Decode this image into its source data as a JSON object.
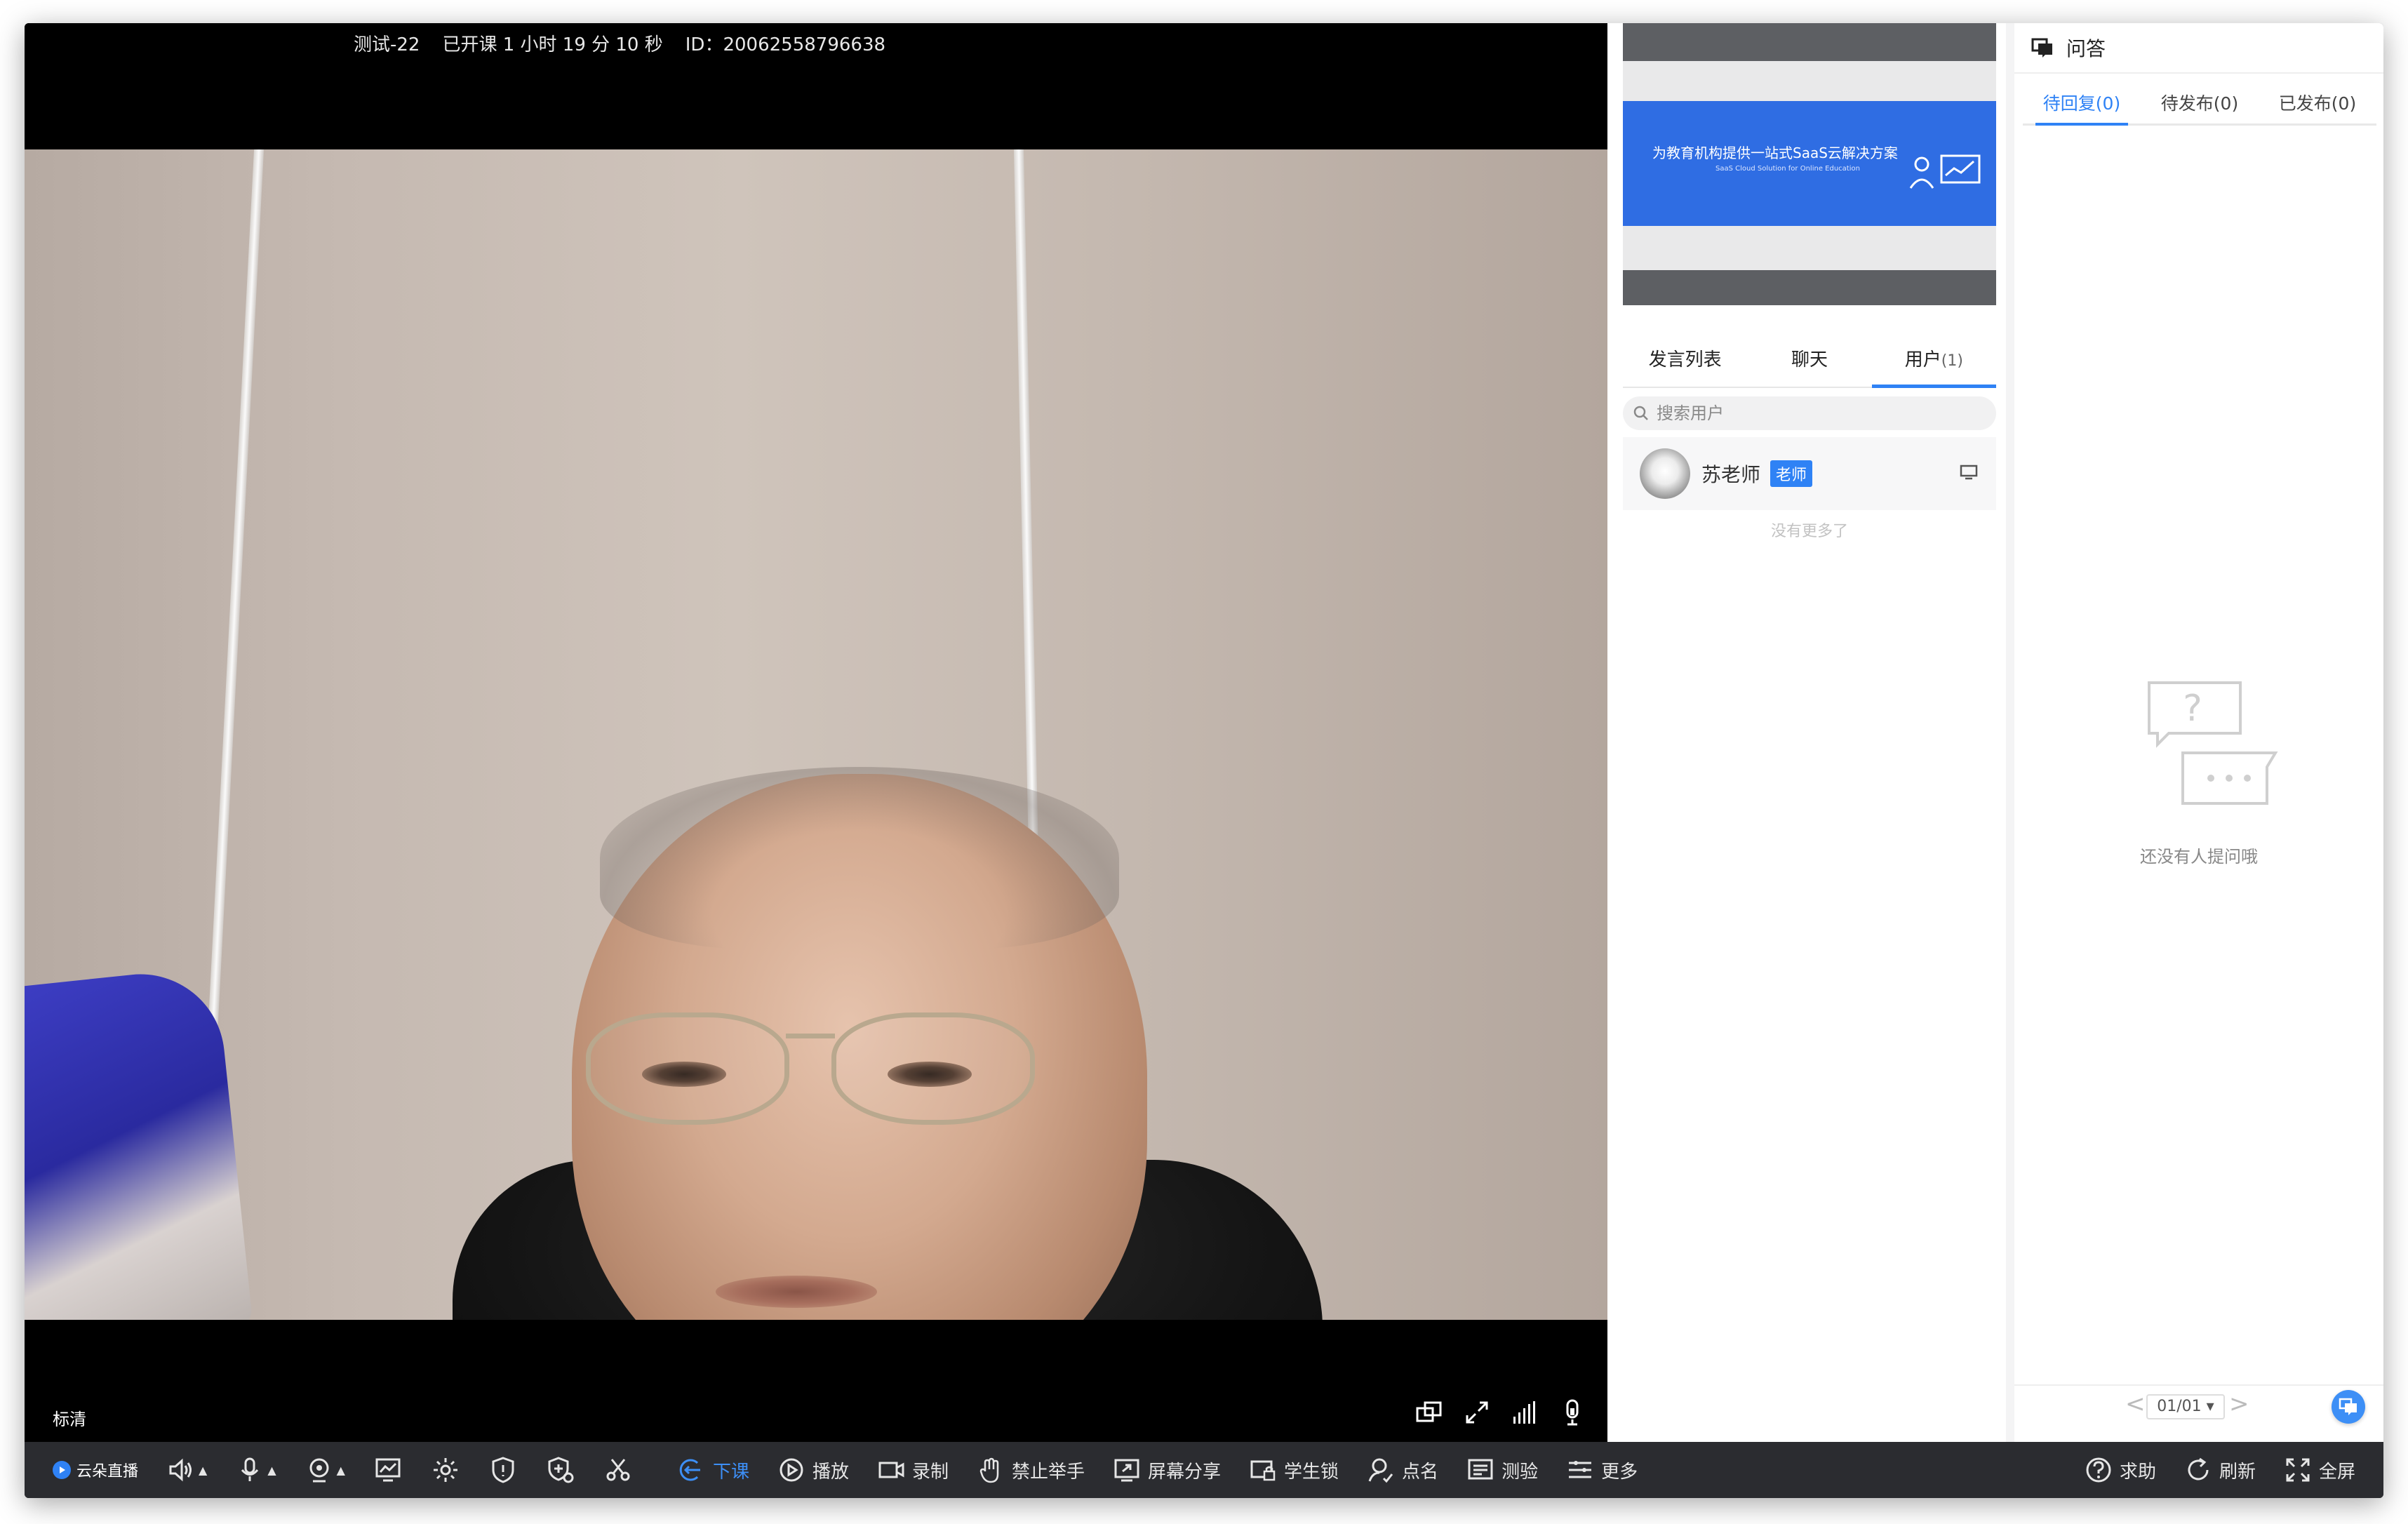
{
  "header": {
    "course_name": "测试-22",
    "elapsed": "已开课 1 小时 19 分 10 秒",
    "session_id": "ID：20062558796638"
  },
  "video": {
    "quality_label": "标清"
  },
  "slide": {
    "title": "为教育机构提供一站式SaaS云解决方案",
    "subtitle": "SaaS Cloud Solution for Online Education"
  },
  "side_tabs": [
    {
      "label": "发言列表",
      "count": ""
    },
    {
      "label": "聊天",
      "count": ""
    },
    {
      "label": "用户",
      "count": "(1)"
    }
  ],
  "user_search": {
    "placeholder": "搜索用户"
  },
  "users": [
    {
      "name": "苏老师",
      "role": "老师"
    }
  ],
  "user_list_end": "没有更多了",
  "qa": {
    "title": "问答",
    "tabs": [
      "待回复(0)",
      "待发布(0)",
      "已发布(0)"
    ],
    "empty_text": "还没有人提问哦",
    "page": "01/01",
    "page_prev": "<",
    "page_next": ">"
  },
  "toolbar": {
    "brand": "云朵直播",
    "actions": [
      {
        "label": "下课",
        "icon": "exit-class-icon"
      },
      {
        "label": "播放",
        "icon": "play-icon"
      },
      {
        "label": "录制",
        "icon": "record-icon"
      },
      {
        "label": "禁止举手",
        "icon": "hand-icon"
      },
      {
        "label": "屏幕分享",
        "icon": "screen-share-icon"
      },
      {
        "label": "学生锁",
        "icon": "student-lock-icon"
      },
      {
        "label": "点名",
        "icon": "roll-call-icon"
      },
      {
        "label": "测验",
        "icon": "quiz-icon"
      },
      {
        "label": "更多",
        "icon": "more-icon"
      }
    ],
    "right": [
      {
        "label": "求助",
        "icon": "help-icon"
      },
      {
        "label": "刷新",
        "icon": "refresh-icon"
      },
      {
        "label": "全屏",
        "icon": "fullscreen-icon"
      }
    ]
  },
  "colors": {
    "accent": "#2f82f5",
    "toolbar_bg": "#2b2c30",
    "stage_bg": "#000000"
  }
}
